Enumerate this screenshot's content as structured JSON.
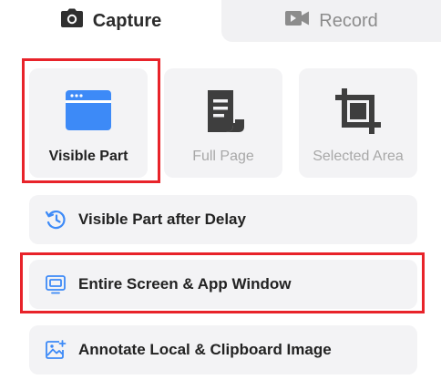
{
  "tabs": {
    "capture": {
      "label": "Capture",
      "icon": "camera-icon"
    },
    "record": {
      "label": "Record",
      "icon": "video-camera-icon"
    }
  },
  "modes": [
    {
      "label": "Visible Part",
      "icon": "browser-window-icon",
      "state": "selected"
    },
    {
      "label": "Full Page",
      "icon": "scroll-icon",
      "state": "disabled"
    },
    {
      "label": "Selected Area",
      "icon": "crop-icon",
      "state": "disabled"
    }
  ],
  "options": [
    {
      "label": "Visible Part after Delay",
      "icon": "timer-icon"
    },
    {
      "label": "Entire Screen & App Window",
      "icon": "windows-icon"
    },
    {
      "label": "Annotate Local & Clipboard Image",
      "icon": "image-edit-icon"
    }
  ],
  "colors": {
    "accent": "#3d8af7",
    "highlight": "#e8232a",
    "card_bg": "#f3f3f5",
    "disabled_icon": "#3e3e3e"
  }
}
